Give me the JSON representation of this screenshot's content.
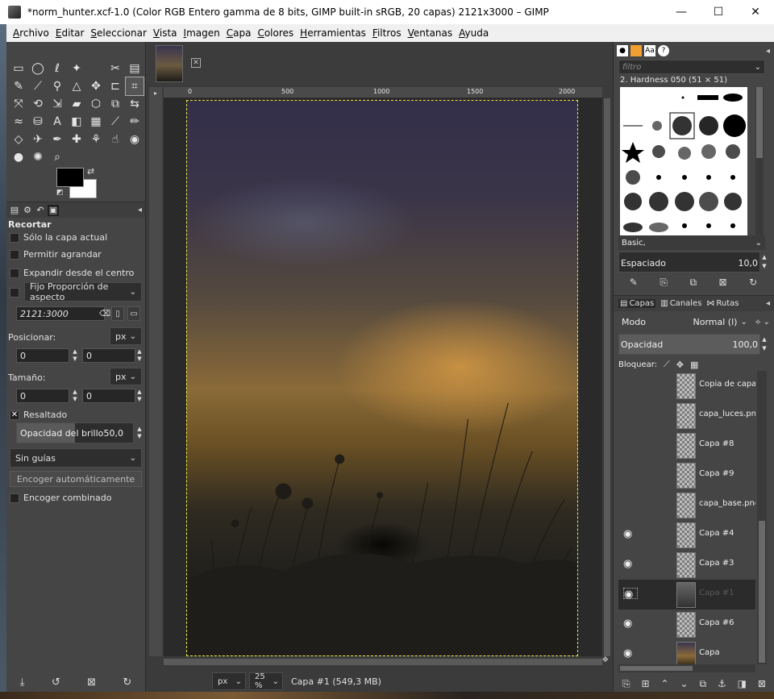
{
  "window": {
    "title": "*norm_hunter.xcf-1.0 (Color RGB Entero gamma de 8 bits, GIMP built-in sRGB, 20 capas) 2121x3000 – GIMP",
    "minimize_glyph": "—",
    "maximize_glyph": "☐",
    "close_glyph": "✕"
  },
  "menu": [
    "Archivo",
    "Editar",
    "Seleccionar",
    "Vista",
    "Imagen",
    "Capa",
    "Colores",
    "Herramientas",
    "Filtros",
    "Ventanas",
    "Ayuda"
  ],
  "tool_options": {
    "title": "Recortar",
    "current_layer_only": "Sólo la capa actual",
    "allow_growing": "Permitir agrandar",
    "expand_from_center": "Expandir desde el centro",
    "fixed_label": "Fijo Proporción de aspecto",
    "aspect_value": "2121:3000",
    "position_label": "Posicionar:",
    "position_unit": "px",
    "position_x": "0",
    "position_y": "0",
    "size_label": "Tamaño:",
    "size_unit": "px",
    "size_w": "0",
    "size_h": "0",
    "highlight_label": "Resaltado",
    "highlight_opacity_label": "Opacidad del brillo",
    "highlight_opacity_value": "50,0",
    "highlight_opacity": 0.5,
    "guides_value": "Sin guías",
    "auto_shrink_label": "Encoger automáticamente",
    "shrink_merged_label": "Encoger combinado"
  },
  "canvas": {
    "ruler_ticks": [
      "0",
      "500",
      "1000",
      "1500",
      "2000"
    ],
    "zoom_unit": "px",
    "zoom_level": "25 %",
    "status": "Capa #1 (549,3 MB)"
  },
  "brushes": {
    "filter_placeholder": "filtro",
    "selected_brush": "2. Hardness 050 (51 × 51)",
    "tag": "Basic,",
    "spacing_label": "Espaciado",
    "spacing_value": "10,0"
  },
  "layers": {
    "tab_layers": "Capas",
    "tab_channels": "Canales",
    "tab_paths": "Rutas",
    "mode_label": "Modo",
    "mode_value": "Normal (l)",
    "opacity_label": "Opacidad",
    "opacity_value": "100,0",
    "opacity": 1.0,
    "lock_label": "Bloquear:",
    "items": [
      {
        "name": "Copia de capa_",
        "visible": false,
        "selected": false,
        "thumb": "checker"
      },
      {
        "name": "capa_luces.png",
        "visible": false,
        "selected": false,
        "thumb": "checker"
      },
      {
        "name": "Capa #8",
        "visible": false,
        "selected": false,
        "thumb": "checker"
      },
      {
        "name": "Capa #9",
        "visible": false,
        "selected": false,
        "thumb": "checker"
      },
      {
        "name": "capa_base.png",
        "visible": false,
        "selected": false,
        "thumb": "checker"
      },
      {
        "name": "Capa #4",
        "visible": true,
        "selected": false,
        "thumb": "checker"
      },
      {
        "name": "Capa #3",
        "visible": true,
        "selected": false,
        "thumb": "checker"
      },
      {
        "name": "Capa #1",
        "visible": true,
        "selected": true,
        "thumb": "dark"
      },
      {
        "name": "Capa #6",
        "visible": true,
        "selected": false,
        "thumb": "checker"
      },
      {
        "name": "Capa",
        "visible": true,
        "selected": false,
        "thumb": "base"
      }
    ]
  }
}
